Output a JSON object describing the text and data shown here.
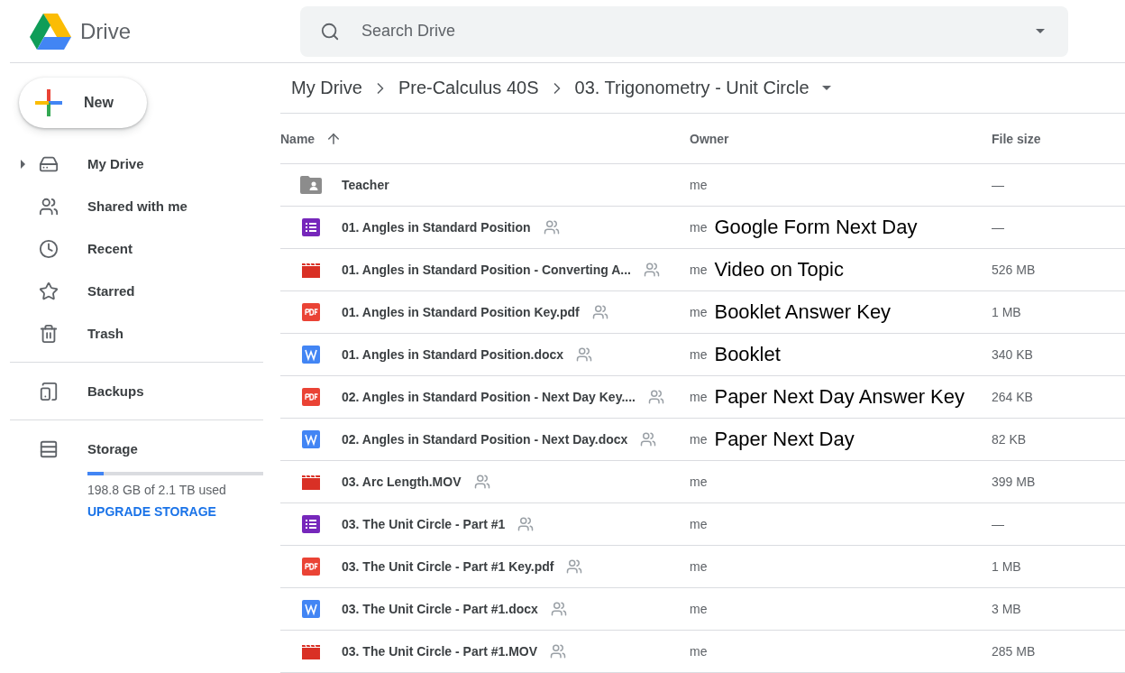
{
  "app": {
    "name": "Drive"
  },
  "search": {
    "placeholder": "Search Drive"
  },
  "new_button": {
    "label": "New"
  },
  "sidebar": {
    "items": [
      {
        "kind": "mydrive",
        "label": "My Drive",
        "expandable": true
      },
      {
        "kind": "shared",
        "label": "Shared with me",
        "expandable": false
      },
      {
        "kind": "recent",
        "label": "Recent",
        "expandable": false
      },
      {
        "kind": "starred",
        "label": "Starred",
        "expandable": false
      },
      {
        "kind": "trash",
        "label": "Trash",
        "expandable": false
      }
    ],
    "backups": {
      "label": "Backups"
    },
    "storage": {
      "label": "Storage",
      "level": 0.09,
      "usage": "198.8 GB of 2.1 TB used",
      "upgrade": "UPGRADE STORAGE"
    }
  },
  "breadcrumb": [
    "My Drive",
    "Pre-Calculus 40S",
    "03. Trigonometry - Unit Circle"
  ],
  "table": {
    "columns": [
      "Name",
      "Owner",
      "File size"
    ],
    "rows": [
      {
        "kind": "folder",
        "name": "Teacher",
        "shared": false,
        "owner": "me",
        "size": "—"
      },
      {
        "kind": "form",
        "name": "01. Angles in Standard Position",
        "shared": true,
        "owner": "me",
        "note": "Google Form Next Day",
        "size": "—"
      },
      {
        "kind": "video",
        "name": "01. Angles in Standard Position - Converting A...",
        "shared": true,
        "owner": "me",
        "note": "Video on Topic",
        "size": "526 MB"
      },
      {
        "kind": "pdf",
        "name": "01. Angles in Standard Position Key.pdf",
        "shared": true,
        "owner": "me",
        "note": "Booklet Answer Key",
        "size": "1 MB"
      },
      {
        "kind": "word",
        "name": "01. Angles in Standard Position.docx",
        "shared": true,
        "owner": "me",
        "note": "Booklet",
        "size": "340 KB"
      },
      {
        "kind": "pdf",
        "name": "02. Angles in Standard Position - Next Day Key....",
        "shared": true,
        "owner": "me",
        "note": "Paper Next Day Answer Key",
        "size": "264 KB"
      },
      {
        "kind": "word",
        "name": "02. Angles in Standard Position - Next Day.docx",
        "shared": true,
        "owner": "me",
        "note": "Paper Next Day",
        "size": "82 KB"
      },
      {
        "kind": "video",
        "name": "03. Arc Length.MOV",
        "shared": true,
        "owner": "me",
        "size": "399 MB"
      },
      {
        "kind": "form",
        "name": "03. The Unit Circle - Part #1",
        "shared": true,
        "owner": "me",
        "size": "—"
      },
      {
        "kind": "pdf",
        "name": "03. The Unit Circle - Part #1 Key.pdf",
        "shared": true,
        "owner": "me",
        "size": "1 MB"
      },
      {
        "kind": "word",
        "name": "03. The Unit Circle - Part #1.docx",
        "shared": true,
        "owner": "me",
        "size": "3 MB"
      },
      {
        "kind": "video",
        "name": "03. The Unit Circle - Part #1.MOV",
        "shared": true,
        "owner": "me",
        "size": "285 MB"
      }
    ]
  }
}
